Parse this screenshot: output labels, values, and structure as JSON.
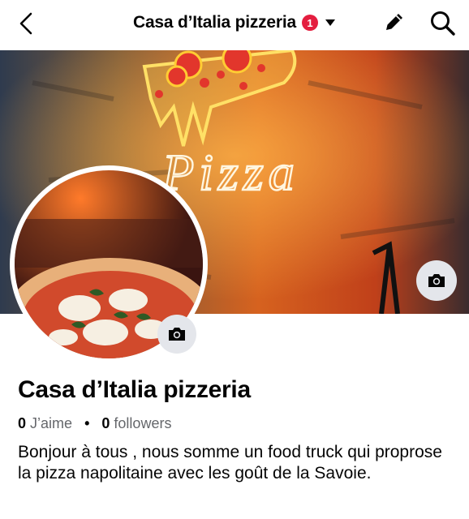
{
  "header": {
    "title": "Casa d’Italia pizzeria",
    "notification_count": "1",
    "icons": [
      "back-chevron-icon",
      "caret-down-icon",
      "edit-pencil-icon",
      "search-icon"
    ]
  },
  "cover": {
    "neon_text": "Pizza",
    "camera_icon": "camera-icon"
  },
  "profile": {
    "name": "Casa d’Italia pizzeria",
    "likes_count": "0",
    "likes_label": "J’aime",
    "separator": "•",
    "followers_count": "0",
    "followers_label": "followers",
    "bio": "Bonjour à tous , nous somme un food truck qui proprose la pizza napolitaine avec les goût de la Savoie."
  },
  "colors": {
    "badge": "#e41e3f",
    "icon_bg": "#e4e6eb",
    "muted_text": "#65676b"
  }
}
